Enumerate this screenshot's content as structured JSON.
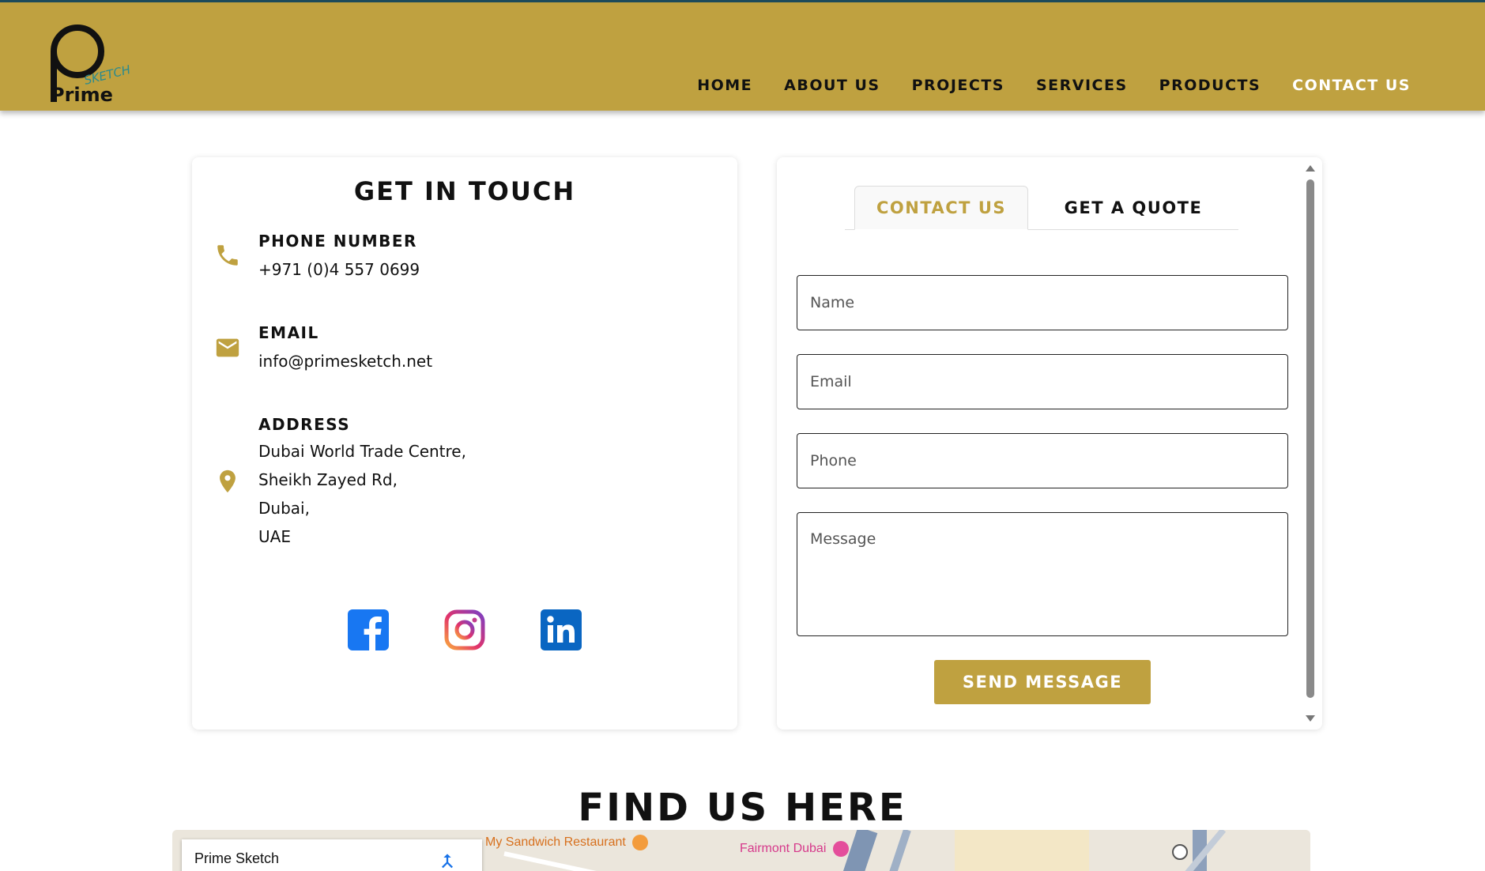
{
  "brand": {
    "logo_text": "Prime",
    "logo_subtext": "SKETCH",
    "accent": "#bfa140",
    "teal": "#2a8a8e"
  },
  "nav": {
    "items": [
      {
        "label": "HOME",
        "active": false
      },
      {
        "label": "ABOUT US",
        "active": false
      },
      {
        "label": "PROJECTS",
        "active": false
      },
      {
        "label": "SERVICES",
        "active": false
      },
      {
        "label": "PRODUCTS",
        "active": false
      },
      {
        "label": "CONTACT US",
        "active": true
      }
    ]
  },
  "contact_info": {
    "title": "GET IN TOUCH",
    "phone": {
      "label": "PHONE NUMBER",
      "value": "+971 (0)4 557 0699",
      "icon": "phone-icon"
    },
    "email": {
      "label": "EMAIL",
      "value": "info@primesketch.net",
      "icon": "mail-icon"
    },
    "address": {
      "label": "ADDRESS",
      "lines": [
        "Dubai World Trade Centre,",
        "Sheikh Zayed Rd,",
        "Dubai,",
        "UAE"
      ],
      "icon": "location-pin-icon"
    },
    "socials": [
      "facebook-icon",
      "instagram-icon",
      "linkedin-icon"
    ]
  },
  "form": {
    "tabs": [
      {
        "label": "CONTACT US",
        "active": true
      },
      {
        "label": "GET A QUOTE",
        "active": false
      }
    ],
    "name_placeholder": "Name",
    "email_placeholder": "Email",
    "phone_placeholder": "Phone",
    "message_placeholder": "Message",
    "submit_label": "SEND MESSAGE"
  },
  "find_us": {
    "title": "FIND US HERE",
    "map": {
      "place_card_title": "Prime Sketch",
      "labels": [
        {
          "text": "My Sandwich Restaurant",
          "color": "#d7701d"
        },
        {
          "text": "Fairmont Dubai",
          "color": "#d6398b"
        }
      ]
    }
  }
}
